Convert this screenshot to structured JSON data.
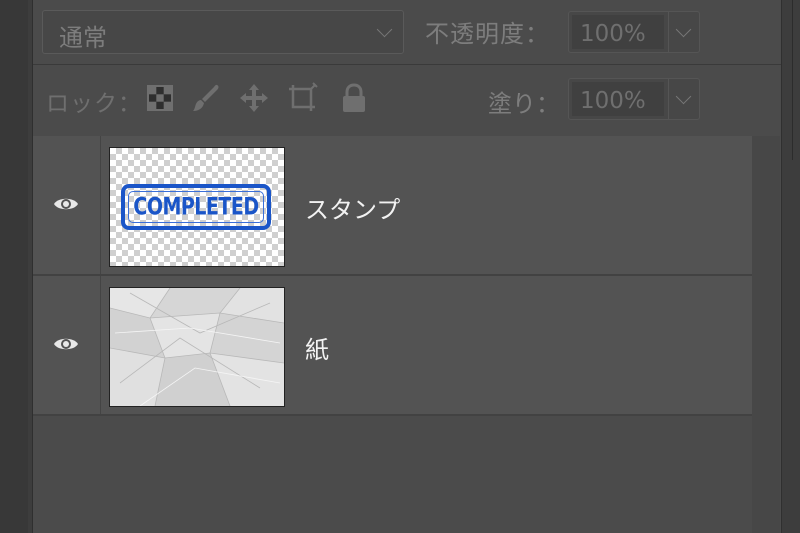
{
  "blend_mode": {
    "selected": "通常"
  },
  "opacity": {
    "label": "不透明度：",
    "value": "100%"
  },
  "fill": {
    "label": "塗り：",
    "value": "100%"
  },
  "lock": {
    "label": "ロック：",
    "icons": [
      "lock-transparent-pixels-icon",
      "lock-image-pixels-icon",
      "lock-position-icon",
      "lock-artboard-icon",
      "lock-all-icon"
    ]
  },
  "layers": [
    {
      "name": "スタンプ",
      "visible": true,
      "thumbnail": "stamp",
      "stamp_text": "COMPLETED",
      "stamp_color": "#1a55c8"
    },
    {
      "name": "紙",
      "visible": true,
      "thumbnail": "crumpled-paper"
    }
  ],
  "colors": {
    "panel_bg": "#4b4b4b",
    "layer_bg": "#535353",
    "text_dim": "#7d7d7d",
    "text_light": "#f2f2f2"
  }
}
